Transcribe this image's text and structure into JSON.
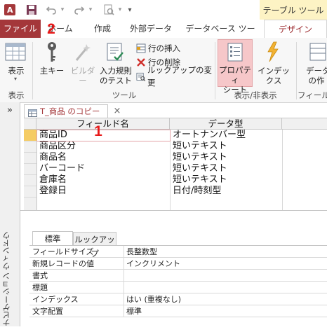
{
  "quick_access": {
    "dropdown_glyph": "▾"
  },
  "contextual_tab_group": "テーブル ツール",
  "tabs": [
    {
      "label": "ファイル"
    },
    {
      "label": "ホーム"
    },
    {
      "label": "作成"
    },
    {
      "label": "外部データ"
    },
    {
      "label": "データベース ツール"
    },
    {
      "label": "デザイン"
    }
  ],
  "annotations": {
    "step2": "2",
    "step1": "1"
  },
  "ribbon": {
    "view": {
      "label": "表示",
      "group": "表示"
    },
    "primary_key": "主キー",
    "builder": "ビルダー",
    "test_rules": {
      "line1": "入力規則",
      "line2": "のテスト"
    },
    "insert_rows": "行の挿入",
    "delete_rows": "行の削除",
    "lookup_change": "ルックアップの変更",
    "tools_group": "ツール",
    "property_sheet": {
      "line1": "プロパティ",
      "line2": "シート"
    },
    "indexes": "インデックス",
    "show_hide_group": "表示/非表示",
    "data_macro": {
      "line1": "データ",
      "line2": "の作"
    },
    "field_group": "フィールド"
  },
  "nav_pane": {
    "toggle": "»",
    "title": "ナビゲーション ウィンドウ"
  },
  "document": {
    "tab": "T_商品 のコピー",
    "close": "×"
  },
  "grid": {
    "headers": {
      "field_name": "フィールド名",
      "data_type": "データ型"
    },
    "rows": [
      {
        "name": "商品ID",
        "type": "オートナンバー型"
      },
      {
        "name": "商品区分",
        "type": "短いテキスト"
      },
      {
        "name": "商品名",
        "type": "短いテキスト"
      },
      {
        "name": "バーコード",
        "type": "短いテキスト"
      },
      {
        "name": "倉庫名",
        "type": "短いテキスト"
      },
      {
        "name": "登録日",
        "type": "日付/時刻型"
      }
    ]
  },
  "properties": {
    "tabs": [
      "標準",
      "ルックアップ"
    ],
    "rows": [
      {
        "label": "フィールドサイズ",
        "value": "長整数型"
      },
      {
        "label": "新規レコードの値",
        "value": "インクリメント"
      },
      {
        "label": "書式",
        "value": ""
      },
      {
        "label": "標題",
        "value": ""
      },
      {
        "label": "インデックス",
        "value": "はい (重複なし)"
      },
      {
        "label": "文字配置",
        "value": "標準"
      }
    ]
  },
  "colors": {
    "file_tab": "#a4373a",
    "accent": "#9c2a2e",
    "annotation": "#e81919",
    "selected_ribbon": "#f6c7c9"
  }
}
